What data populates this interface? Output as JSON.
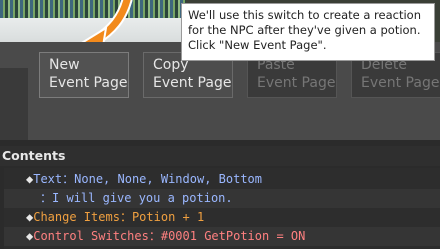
{
  "tooltip": {
    "lines": [
      "We'll use this switch to create a reaction",
      "for the NPC after they've given a potion.",
      "Click \"New Event Page\"."
    ]
  },
  "toolbar": {
    "buttons": [
      {
        "line1": "New",
        "line2": "Event Page",
        "state": "enabled"
      },
      {
        "line1": "Copy",
        "line2": "Event Page",
        "state": "enabled"
      },
      {
        "line1": "Paste",
        "line2": "Event Page",
        "state": "disabled"
      },
      {
        "line1": "Delete",
        "line2": "Event Page",
        "state": "disabled"
      }
    ]
  },
  "contents": {
    "title": "Contents",
    "rows": [
      {
        "bullet": "◆",
        "label": "Text",
        "sep": "：",
        "value": "None, None, Window, Bottom"
      },
      {
        "bullet": "",
        "label": "",
        "sep": "：",
        "value": "I will give you a potion."
      },
      {
        "bullet": "◆",
        "label": "Change Items",
        "sep": "：",
        "value": "Potion + 1"
      },
      {
        "bullet": "◆",
        "label": "Control Switches",
        "sep": "：",
        "value": "#0001 GetPotion = ON"
      }
    ]
  },
  "colors": {
    "arrow": "#f28a1c",
    "text_command": "#9ab7ff",
    "item_command": "#f0a040",
    "switch_command": "#ff8080"
  }
}
